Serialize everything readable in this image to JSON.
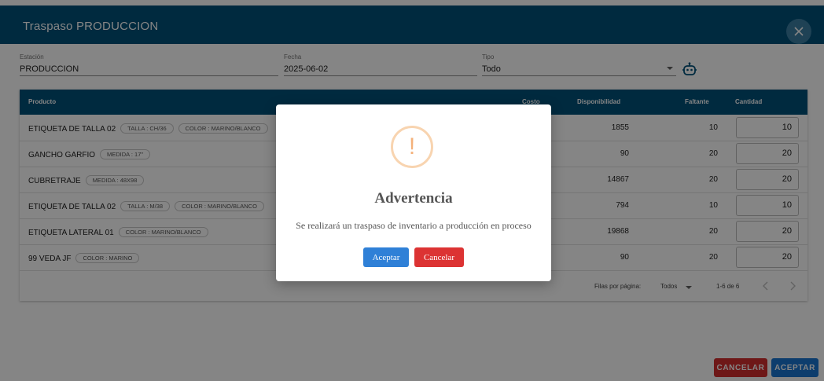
{
  "header": {
    "title": "Traspaso PRODUCCION"
  },
  "form": {
    "estacion": {
      "label": "Estación",
      "value": "PRODUCCION"
    },
    "fecha": {
      "label": "Fecha",
      "value": "2025-06-02"
    },
    "tipo": {
      "label": "Tipo",
      "value": "Todo"
    }
  },
  "table": {
    "headers": {
      "producto": "Producto",
      "costo": "Costo",
      "disponibilidad": "Disponibilidad",
      "faltante": "Faltante",
      "cantidad": "Cantidad"
    },
    "rows": [
      {
        "name": "ETIQUETA DE TALLA 02",
        "chips": [
          "TALLA : CH/36",
          "COLOR : MARINO/BLANCO"
        ],
        "disponibilidad": "1855",
        "faltante": "10",
        "cantidad": "10"
      },
      {
        "name": "GANCHO GARFIO",
        "chips": [
          "MEDIDA : 17\""
        ],
        "disponibilidad": "90",
        "faltante": "20",
        "cantidad": "20"
      },
      {
        "name": "CUBRETRAJE",
        "chips": [
          "MEDIDA : 48X98"
        ],
        "disponibilidad": "14867",
        "faltante": "20",
        "cantidad": "20"
      },
      {
        "name": "ETIQUETA DE TALLA 02",
        "chips": [
          "TALLA : M/38",
          "COLOR : MARINO/BLANCO"
        ],
        "disponibilidad": "794",
        "faltante": "10",
        "cantidad": "10"
      },
      {
        "name": "ETIQUETA LATERAL 01",
        "chips": [
          "COLOR : MARINO/BLANCO"
        ],
        "disponibilidad": "19868",
        "faltante": "20",
        "cantidad": "20"
      },
      {
        "name": "99 VEDA JF",
        "chips": [
          "COLOR : MARINO"
        ],
        "disponibilidad": "90",
        "faltante": "20",
        "cantidad": "20"
      }
    ],
    "footer": {
      "rows_per_page_label": "Filas por página:",
      "rows_per_page_value": "Todos",
      "range": "1-6 de 6"
    }
  },
  "dialog": {
    "title": "Advertencia",
    "message": "Se realizará un traspaso de inventario a producción en proceso",
    "confirm_label": "Aceptar",
    "cancel_label": "Cancelar",
    "icon": "exclamation-circle-icon",
    "icon_symbol": "!"
  },
  "actions": {
    "cancel_label": "CANCELAR",
    "accept_label": "ACEPTAR"
  },
  "colors": {
    "primary": "#00527a",
    "danger": "#d32f2f",
    "info": "#1976d2",
    "warning": "#f4b17a"
  }
}
